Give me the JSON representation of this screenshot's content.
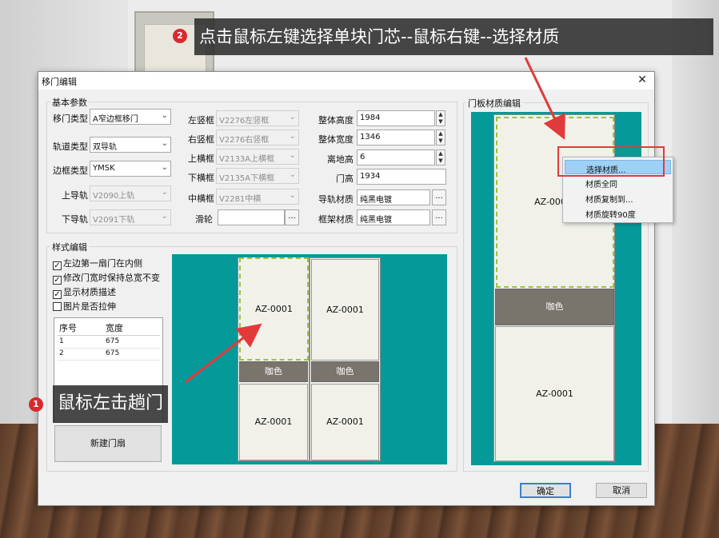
{
  "window": {
    "title": "移门编辑",
    "close": "✕"
  },
  "basic": {
    "title": "基本参数",
    "door_type_label": "移门类型",
    "door_type_value": "A窄边框移门",
    "track_type_label": "轨道类型",
    "track_type_value": "双导轨",
    "frame_type_label": "边框类型",
    "frame_type_value": "YMSK",
    "upper_rail_label": "上导轨",
    "upper_rail_value": "V2090上轨",
    "lower_rail_label": "下导轨",
    "lower_rail_value": "V2091下轨",
    "left_stile_label": "左竖框",
    "left_stile_value": "V2276左竖框",
    "right_stile_label": "右竖框",
    "right_stile_value": "V2276右竖框",
    "top_rail_label": "上横框",
    "top_rail_value": "V2133A上横框",
    "bottom_rail_label": "下横框",
    "bottom_rail_value": "V2135A下横框",
    "mid_rail_label": "中横框",
    "mid_rail_value": "V2281中横",
    "pulley_label": "滑轮",
    "pulley_value": "",
    "total_height_label": "整体高度",
    "total_height_value": "1984",
    "total_width_label": "整体宽度",
    "total_width_value": "1346",
    "ground_height_label": "离地高",
    "ground_height_value": "6",
    "door_height_label": "门高",
    "door_height_value": "1934",
    "rail_material_label": "导轨材质",
    "rail_material_value": "纯黑电镀",
    "frame_material_label": "框架材质",
    "frame_material_value": "纯黑电镀",
    "dots": "..."
  },
  "style": {
    "title": "样式编辑",
    "checks": [
      {
        "label": "左边第一扇门在内侧",
        "checked": "✓"
      },
      {
        "label": "修改门宽时保持总宽不变",
        "checked": "✓"
      },
      {
        "label": "显示材质描述",
        "checked": "✓"
      },
      {
        "label": "图片是否拉伸",
        "checked": ""
      }
    ],
    "table_headers": [
      "序号",
      "宽度"
    ],
    "rows": [
      [
        "1",
        "675"
      ],
      [
        "2",
        "675"
      ]
    ],
    "new_door_button": "新建门扇"
  },
  "preview": {
    "core_label": "AZ-0001",
    "band_label": "咖色"
  },
  "material": {
    "title": "门板材质编辑",
    "core_label_top": "AZ-000",
    "band_label": "咖色",
    "core_label_bottom": "AZ-0001"
  },
  "context_menu": {
    "items": [
      "选择材质...",
      "材质全同",
      "材质复制到...",
      "材质旋转90度"
    ]
  },
  "buttons": {
    "ok": "确定",
    "cancel": "取消"
  },
  "callouts": {
    "one": {
      "badge": "1",
      "text": "鼠标左击趟门"
    },
    "two": {
      "badge": "2",
      "text": "点击鼠标左键选择单块门芯--鼠标右键--选择材质"
    }
  },
  "colors": {
    "teal": "#06999a",
    "band": "#7a756c",
    "highlight": "#9fd0f5",
    "annotation_red": "#e23a3a",
    "selection_green": "#9ac43a"
  }
}
